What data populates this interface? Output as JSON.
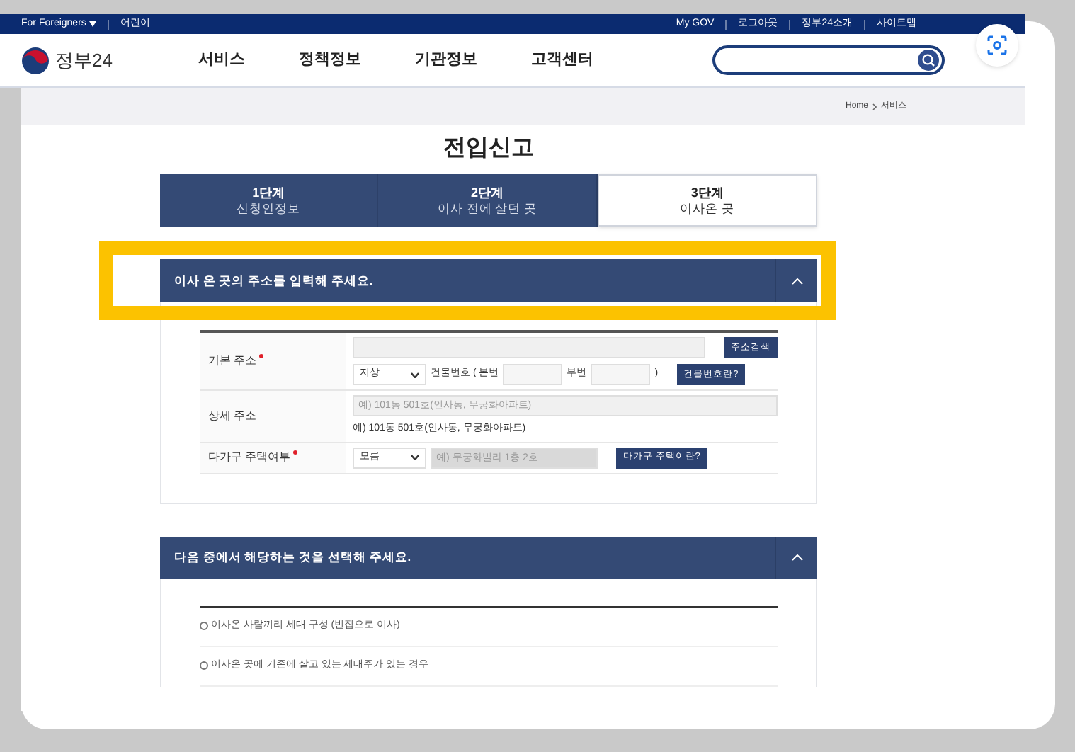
{
  "top_bar": {
    "left_links": [
      {
        "label": "For Foreigners",
        "dropdown": true
      },
      {
        "label": "어린이",
        "dropdown": false
      }
    ],
    "right_links": [
      "My GOV",
      "로그아웃",
      "정부24소개",
      "사이트맵"
    ]
  },
  "header": {
    "logo_text": "정부24",
    "nav": [
      "서비스",
      "정책정보",
      "기관정보",
      "고객센터"
    ]
  },
  "breadcrumb": [
    "Home",
    "서비스"
  ],
  "title": "전입신고",
  "steps": [
    {
      "step": "1단계",
      "label": "신청인정보",
      "selected": false
    },
    {
      "step": "2단계",
      "label": "이사 전에 살던 곳",
      "selected": false
    },
    {
      "step": "3단계",
      "label": "이사온 곳",
      "selected": true
    }
  ],
  "address_section": {
    "title": "이사 온 곳의 주소를 입력해 주세요.",
    "expanded": true,
    "highlighted": true,
    "rows": [
      {
        "label": "기본 주소",
        "required": true,
        "controls": [
          {
            "kind": "longinput"
          },
          {
            "kind": "button",
            "label": "주소검색"
          },
          {
            "kind": "break"
          },
          {
            "kind": "select",
            "value": "지상"
          },
          {
            "kind": "text",
            "label": "건물번호 ( 본번"
          },
          {
            "kind": "shortinput"
          },
          {
            "kind": "text",
            "label": "부번"
          },
          {
            "kind": "shortinput"
          },
          {
            "kind": "text",
            "label": ")"
          },
          {
            "kind": "button",
            "label": "건물번호란?"
          }
        ]
      },
      {
        "label": "상세 주소",
        "required": false,
        "controls": [
          {
            "kind": "longinput",
            "placeholder": "예) 101동 501호(인사동, 무궁화아파트)"
          },
          {
            "kind": "break"
          },
          {
            "kind": "text",
            "label": "예) 101동 501호(인사동, 무궁화아파트)"
          }
        ]
      },
      {
        "label": "다가구 주택여부",
        "required": true,
        "controls": [
          {
            "kind": "select",
            "value": "모름"
          },
          {
            "kind": "input",
            "placeholder": "예) 무궁화빌라 1층 2호"
          },
          {
            "kind": "button",
            "label": "다가구 주택이란?"
          }
        ]
      }
    ]
  },
  "choice_section": {
    "title": "다음 중에서 해당하는 것을 선택해 주세요.",
    "expanded": true,
    "highlighted": false,
    "options": [
      {
        "label": "이사온 사람끼리 세대 구성 (빈집으로 이사)",
        "selected": false
      },
      {
        "label": "이사온 곳에 기존에 살고 있는 세대주가 있는 경우",
        "selected": false
      }
    ]
  }
}
